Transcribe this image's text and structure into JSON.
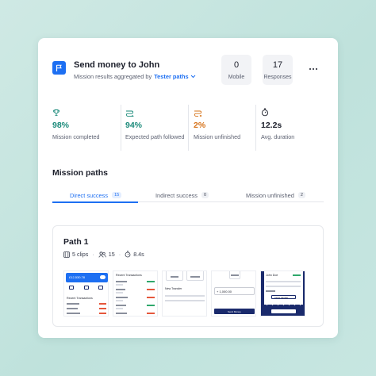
{
  "header": {
    "title": "Send money to John",
    "subtitle_prefix": "Mission results aggregated by",
    "subtitle_link": "Tester paths"
  },
  "stats": [
    {
      "value": "0",
      "label": "Mobile"
    },
    {
      "value": "17",
      "label": "Responses"
    }
  ],
  "metrics": [
    {
      "value": "98%",
      "label": "Mission completed",
      "color": "#1b8a7a",
      "icon": "trophy-icon"
    },
    {
      "value": "94%",
      "label": "Expected path followed",
      "color": "#1b8a7a",
      "icon": "path-icon"
    },
    {
      "value": "2%",
      "label": "Mission unfinished",
      "color": "#d6731a",
      "icon": "unfinished-path-icon"
    },
    {
      "value": "12.2s",
      "label": "Avg. duration",
      "color": "#1c1f2b",
      "icon": "stopwatch-icon"
    }
  ],
  "section": {
    "title": "Mission paths"
  },
  "tabs": [
    {
      "label": "Direct success",
      "count": "15"
    },
    {
      "label": "Indirect success",
      "count": "0"
    },
    {
      "label": "Mission unfinished",
      "count": "2"
    }
  ],
  "path": {
    "title": "Path 1",
    "clips": "5 clips",
    "testers": "15",
    "duration": "8.4s"
  },
  "clip_texts": {
    "balance": "£12,530.78",
    "recent_transactions": "Recent Transactions",
    "new_transfer": "New Transfer",
    "amount": "+ 1,000.00",
    "send_money": "Send Money",
    "john_doe": "John Doe",
    "confirm": "Close transfer"
  },
  "colors": {
    "accent": "#1d6ff2",
    "success": "#1b8a7a",
    "warning": "#d6731a",
    "navy": "#1a2a6c"
  }
}
